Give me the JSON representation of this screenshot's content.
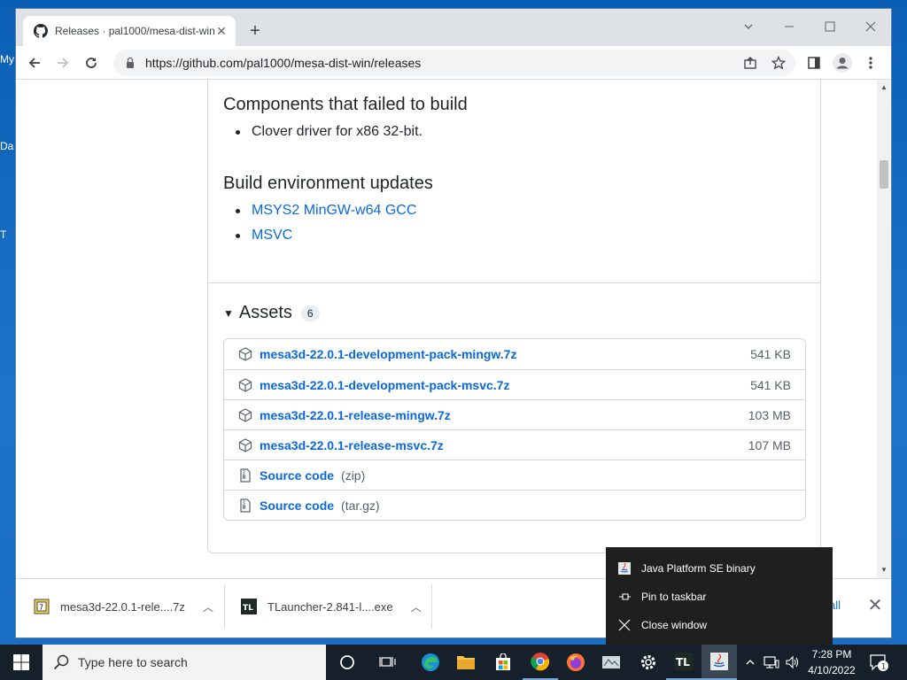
{
  "desktop": {
    "labels": [
      "My",
      "Da",
      "T"
    ]
  },
  "browser": {
    "tab": {
      "title": "Releases · pal1000/mesa-dist-win"
    },
    "toolbar": {
      "url": "https://github.com/pal1000/mesa-dist-win/releases"
    },
    "content": {
      "failed_heading": "Components that failed to build",
      "failed_items": [
        "Clover driver for x86 32-bit."
      ],
      "env_heading": "Build environment updates",
      "env_items": [
        "MSYS2 MinGW-w64 GCC",
        "MSVC"
      ],
      "assets_label": "Assets",
      "assets_count": "6",
      "assets": [
        {
          "name": "mesa3d-22.0.1-development-pack-mingw.7z",
          "format": "",
          "size": "541 KB",
          "icon": "package-icon"
        },
        {
          "name": "mesa3d-22.0.1-development-pack-msvc.7z",
          "format": "",
          "size": "541 KB",
          "icon": "package-icon"
        },
        {
          "name": "mesa3d-22.0.1-release-mingw.7z",
          "format": "",
          "size": "103 MB",
          "icon": "package-icon"
        },
        {
          "name": "mesa3d-22.0.1-release-msvc.7z",
          "format": "",
          "size": "107 MB",
          "icon": "package-icon"
        },
        {
          "name": "Source code",
          "format": "(zip)",
          "size": "",
          "icon": "file-zip-icon"
        },
        {
          "name": "Source code",
          "format": "(tar.gz)",
          "size": "",
          "icon": "file-zip-icon"
        }
      ]
    },
    "downloads": {
      "items": [
        {
          "name": "mesa3d-22.0.1-rele....7z"
        },
        {
          "name": "TLauncher-2.841-l....exe"
        }
      ],
      "show_all_label": "all"
    }
  },
  "jumplist": {
    "app_name": "Java Platform SE binary",
    "pin_label": "Pin to taskbar",
    "close_label": "Close window"
  },
  "taskbar": {
    "search_placeholder": "Type here to search",
    "time": "7:28 PM",
    "date": "4/10/2022",
    "notification_count": "1"
  },
  "colors": {
    "link": "#0969da",
    "taskbar": "#16202b",
    "desktop": "#1a6ec4"
  }
}
